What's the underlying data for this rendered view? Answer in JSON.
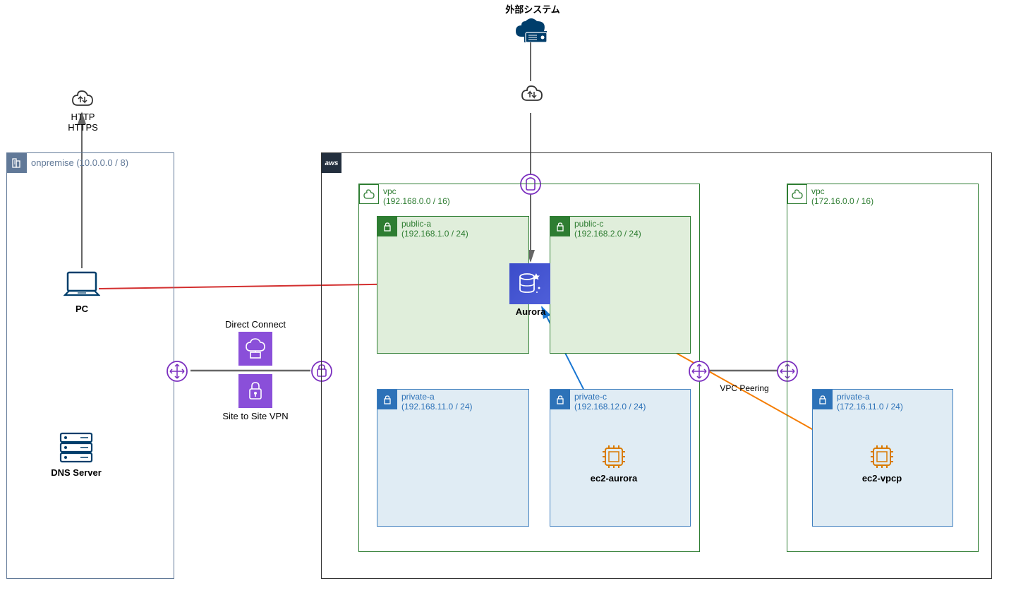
{
  "title_external": "外部システム",
  "onpremise": {
    "name": "onpremise",
    "cidr": "(10.0.0.0 / 8)",
    "pc_label": "PC",
    "dns_label": "DNS Server",
    "http_label": "HTTP\nHTTPS"
  },
  "connections": {
    "direct_connect": "Direct Connect",
    "site_to_site": "Site to Site VPN",
    "vpc_peering": "VPC Peering"
  },
  "aws": {
    "tag": "aws",
    "vpc1": {
      "name": "vpc",
      "cidr": "(192.168.0.0 / 16)",
      "public_a": {
        "name": "public-a",
        "cidr": "(192.168.1.0 / 24)"
      },
      "public_c": {
        "name": "public-c",
        "cidr": "(192.168.2.0 / 24)"
      },
      "private_a": {
        "name": "private-a",
        "cidr": "(192.168.11.0 / 24)"
      },
      "private_c": {
        "name": "private-c",
        "cidr": "(192.168.12.0 / 24)"
      },
      "aurora_label": "Aurora",
      "ec2_aurora_label": "ec2-aurora"
    },
    "vpc2": {
      "name": "vpc",
      "cidr": "(172.16.0.0 / 16)",
      "private_a": {
        "name": "private-a",
        "cidr": "(172.16.11.0 / 24)"
      },
      "ec2_vpcp_label": "ec2-vpcp"
    }
  }
}
